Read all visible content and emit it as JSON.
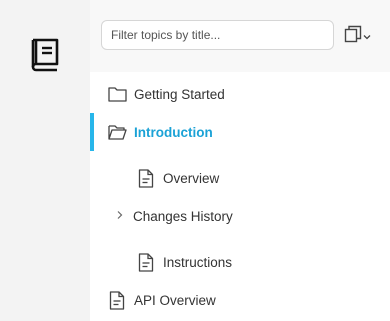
{
  "filter": {
    "placeholder": "Filter topics by title..."
  },
  "tree": {
    "items": [
      {
        "label": "Getting Started",
        "icon": "folder-icon",
        "level": 0,
        "selected": false
      },
      {
        "label": "Introduction",
        "icon": "folder-open-icon",
        "level": 0,
        "selected": true
      },
      {
        "label": "Overview",
        "icon": "document-icon",
        "level": 1,
        "selected": false
      },
      {
        "label": "Changes History",
        "icon": "chevron-right-icon",
        "level": 1,
        "selected": false
      },
      {
        "label": "Instructions",
        "icon": "document-icon",
        "level": 1,
        "selected": false
      },
      {
        "label": "API Overview",
        "icon": "document-icon",
        "level": 0,
        "selected": false
      }
    ]
  },
  "colors": {
    "accent": "#1ba2d6",
    "selection_bar": "#27b6ea"
  }
}
